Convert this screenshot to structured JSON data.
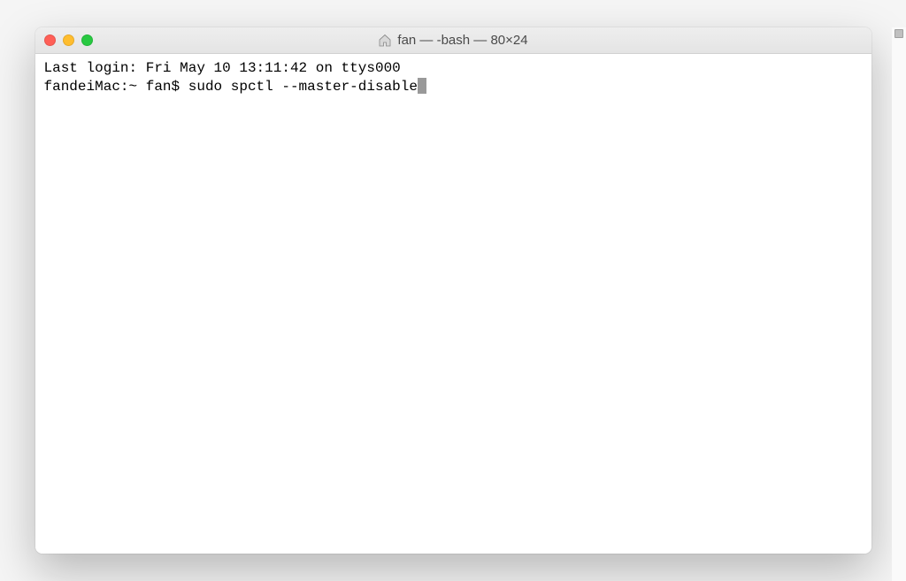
{
  "window": {
    "title": "fan — -bash — 80×24"
  },
  "terminal": {
    "last_login_line": "Last login: Fri May 10 13:11:42 on ttys000",
    "prompt": "fandeiMac:~ fan$ ",
    "command": "sudo spctl --master-disable"
  }
}
